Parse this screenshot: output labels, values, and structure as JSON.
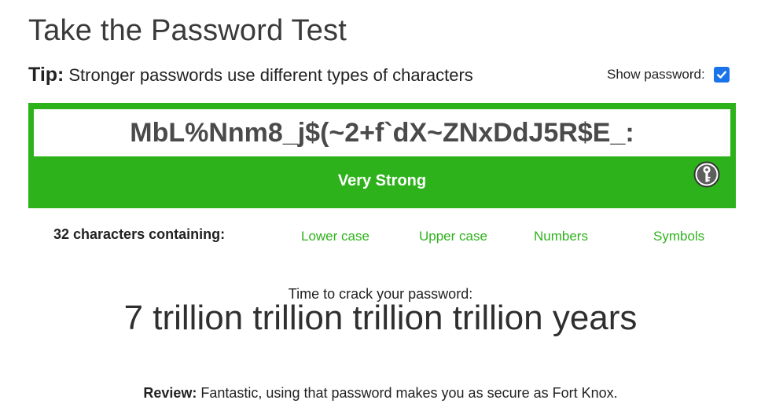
{
  "page": {
    "title": "Take the Password Test"
  },
  "tip": {
    "label": "Tip:",
    "text": "Stronger passwords use different types of characters"
  },
  "show_password": {
    "label": "Show password:",
    "checked": true
  },
  "password": {
    "value": "MbL%Nnm8_j$(~2+f`dX~ZNxDdJ5R$E_:"
  },
  "strength": {
    "label": "Very Strong",
    "color": "#2eb21c",
    "icon": "key-icon"
  },
  "composition": {
    "summary": "32 characters containing:",
    "types": [
      "Lower case",
      "Upper case",
      "Numbers",
      "Symbols"
    ],
    "color": "#2eb21c"
  },
  "crack": {
    "label": "Time to crack your password:",
    "time": "7 trillion trillion trillion trillion years"
  },
  "review": {
    "label": "Review:",
    "text": "Fantastic, using that password makes you as secure as Fort Knox."
  }
}
